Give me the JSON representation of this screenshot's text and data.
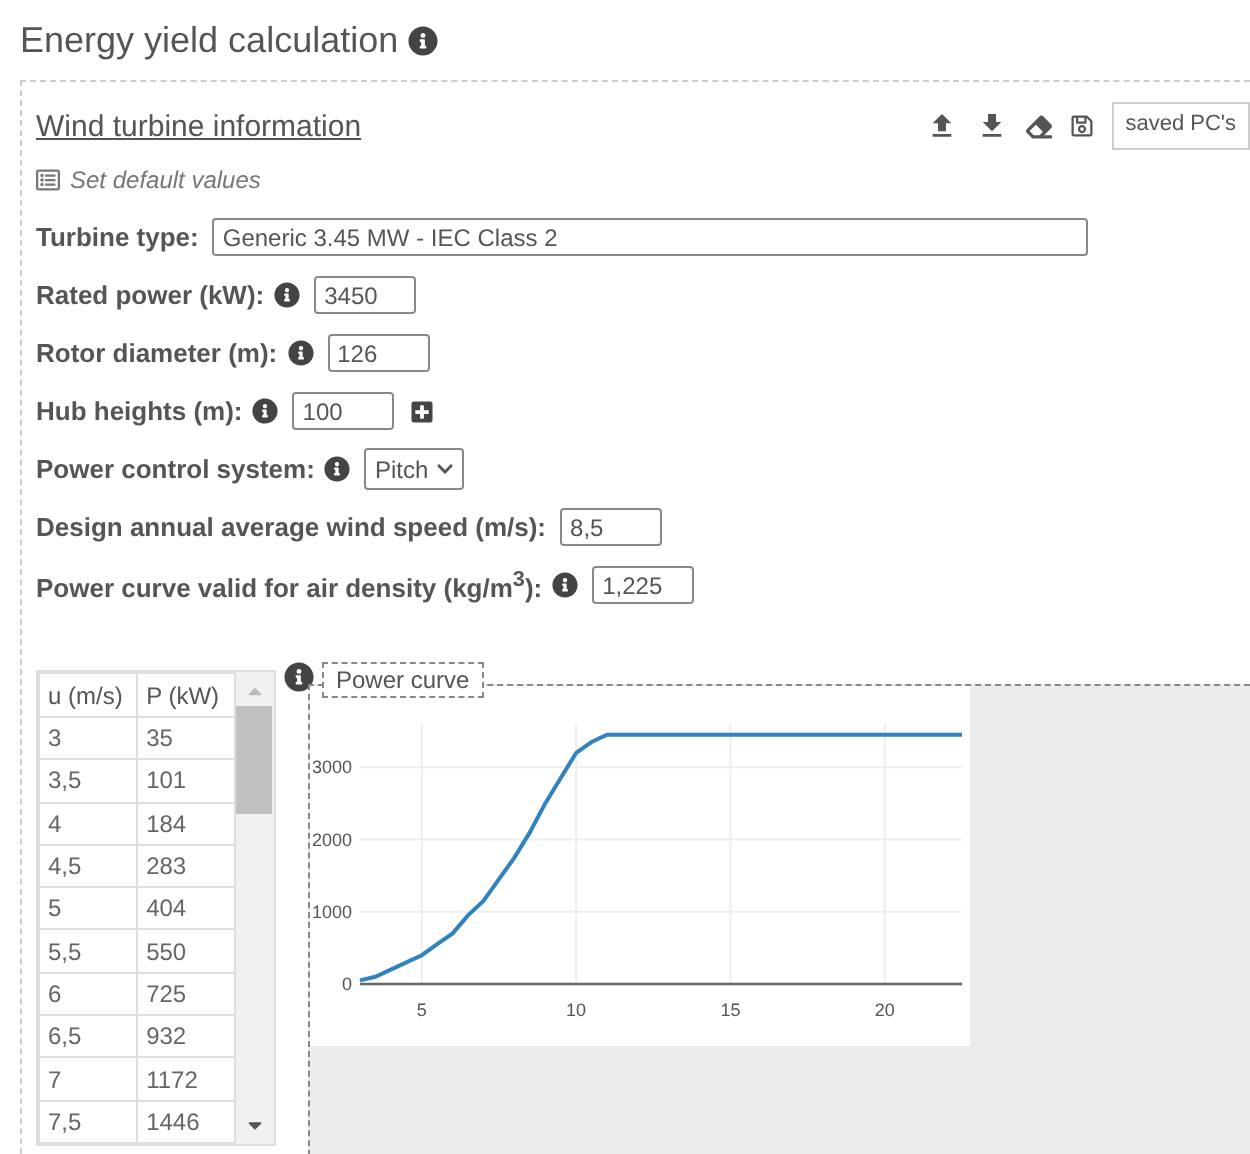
{
  "page_title": "Energy yield calculation",
  "section": {
    "title": "Wind turbine information",
    "default_link": "Set default values",
    "saved_select": "saved PC's"
  },
  "fields": [
    {
      "kind": "long-text",
      "label": "Turbine type:",
      "info": false,
      "value": "Generic 3.45 MW - IEC Class 2",
      "add_button": false
    },
    {
      "kind": "text",
      "label": "Rated power (kW):",
      "info": true,
      "value": "3450",
      "add_button": false
    },
    {
      "kind": "text",
      "label": "Rotor diameter (m):",
      "info": true,
      "value": "126",
      "add_button": false
    },
    {
      "kind": "text",
      "label": "Hub heights (m):",
      "info": true,
      "value": "100",
      "add_button": true
    },
    {
      "kind": "select",
      "label": "Power control system:",
      "info": true,
      "value": "Pitch",
      "add_button": false
    },
    {
      "kind": "text",
      "label": "Design annual average wind speed (m/s):",
      "info": false,
      "value": "8,5",
      "add_button": false
    },
    {
      "kind": "text",
      "label": "Power curve valid for air density (kg/m$^{3}$):",
      "info": true,
      "value": "1,225",
      "add_button": false
    }
  ],
  "power_table": {
    "columns": [
      "u (m/s)",
      "P (kW)"
    ],
    "rows": [
      [
        "3",
        "35"
      ],
      [
        "3,5",
        "101"
      ],
      [
        "4",
        "184"
      ],
      [
        "4,5",
        "283"
      ],
      [
        "5",
        "404"
      ],
      [
        "5,5",
        "550"
      ],
      [
        "6",
        "725"
      ],
      [
        "6,5",
        "932"
      ],
      [
        "7",
        "1172"
      ],
      [
        "7,5",
        "1446"
      ]
    ]
  },
  "chart": {
    "chart_data": {
      "type": "line",
      "grid": true,
      "x": [
        3,
        3.5,
        4,
        4.5,
        5,
        5.5,
        6,
        6.5,
        7,
        7.5,
        8,
        8.5,
        9,
        9.5,
        10,
        10.5,
        11,
        12,
        14,
        16,
        18,
        20,
        22.5
      ],
      "series": [
        {
          "name": "Power curve",
          "color": "#3182bd",
          "values": [
            50,
            100,
            200,
            300,
            400,
            550,
            700,
            950,
            1150,
            1450,
            1750,
            2100,
            2500,
            2850,
            3200,
            3350,
            3450,
            3450,
            3450,
            3450,
            3450,
            3450,
            3450
          ]
        }
      ],
      "xlim": [
        3,
        22.5
      ],
      "ylim": [
        0,
        3600
      ],
      "xticks": [
        5,
        10,
        15,
        20
      ],
      "yticks": [
        0,
        1000,
        2000,
        3000
      ]
    }
  }
}
